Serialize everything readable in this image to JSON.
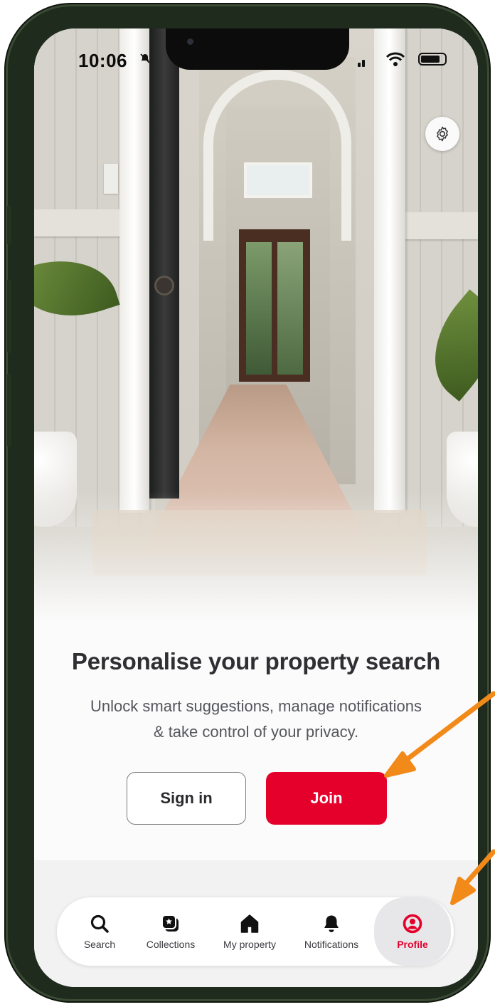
{
  "status_bar": {
    "time": "10:06"
  },
  "content": {
    "title": "Personalise your property search",
    "subtitle_line1": "Unlock smart suggestions, manage notifications",
    "subtitle_line2": "& take control of your privacy.",
    "sign_in_label": "Sign in",
    "join_label": "Join"
  },
  "tabs": [
    {
      "label": "Search",
      "icon": "search-icon"
    },
    {
      "label": "Collections",
      "icon": "collections-icon"
    },
    {
      "label": "My property",
      "icon": "home-icon"
    },
    {
      "label": "Notifications",
      "icon": "bell-icon"
    },
    {
      "label": "Profile",
      "icon": "profile-icon",
      "active": true
    }
  ],
  "colors": {
    "brand_red": "#e4002b",
    "annotation_arrow": "#f28a1a",
    "phone_frame": "#1f2b1c"
  }
}
